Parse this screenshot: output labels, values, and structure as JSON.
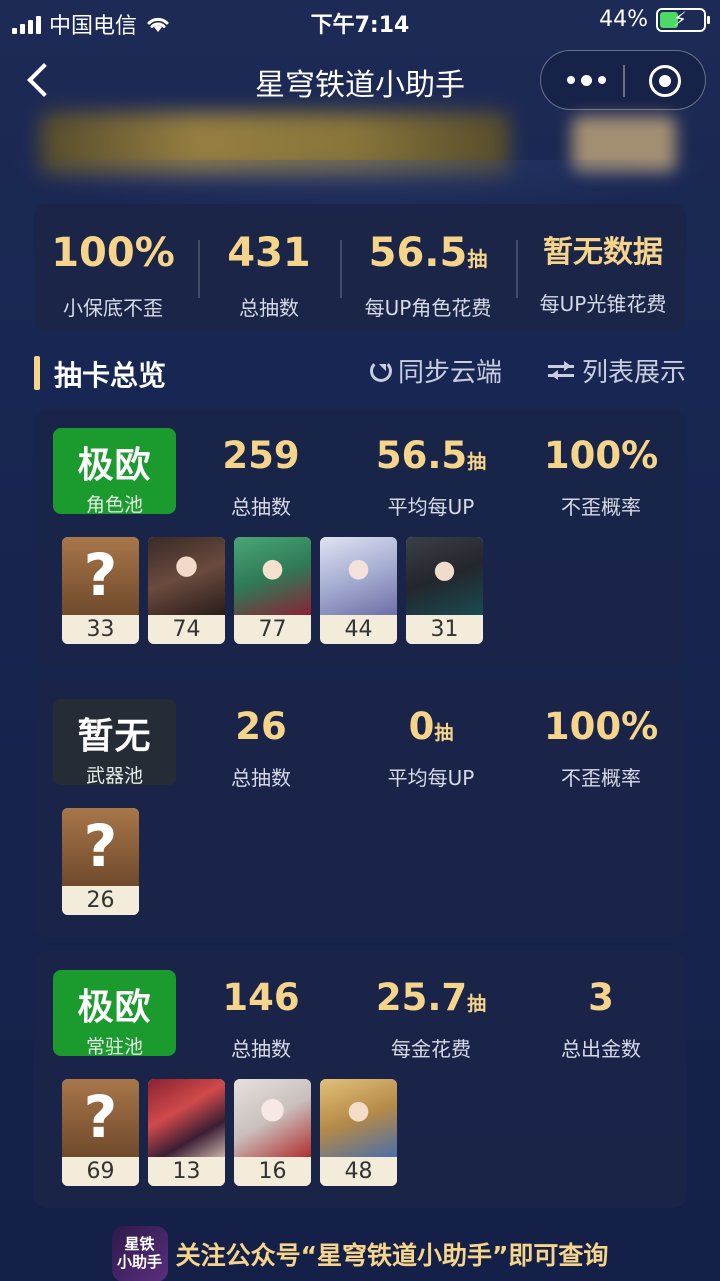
{
  "status": {
    "carrier": "中国电信",
    "time": "下午7:14",
    "battery": "44%"
  },
  "nav": {
    "title": "星穹铁道小助手"
  },
  "summary": [
    {
      "value": "100%",
      "unit": "",
      "label": "小保底不歪"
    },
    {
      "value": "431",
      "unit": "",
      "label": "总抽数"
    },
    {
      "value": "56.5",
      "unit": "抽",
      "label": "每UP角色花费"
    },
    {
      "value": "暂无数据",
      "unit": "",
      "label": "每UP光锥花费"
    }
  ],
  "section": {
    "title": "抽卡总览",
    "sync": "同步云端",
    "list": "列表展示"
  },
  "pools": [
    {
      "badge": "极欧",
      "badge_color": "#1b9a2e",
      "name": "角色池",
      "stats": [
        {
          "value": "259",
          "unit": "",
          "label": "总抽数"
        },
        {
          "value": "56.5",
          "unit": "抽",
          "label": "平均每UP"
        },
        {
          "value": "100%",
          "unit": "",
          "label": "不歪概率"
        }
      ],
      "pulls": [
        "33",
        "74",
        "77",
        "44",
        "31"
      ]
    },
    {
      "badge": "暂无",
      "badge_color": "#262c35",
      "name": "武器池",
      "stats": [
        {
          "value": "26",
          "unit": "",
          "label": "总抽数"
        },
        {
          "value": "0",
          "unit": "抽",
          "label": "平均每UP"
        },
        {
          "value": "100%",
          "unit": "",
          "label": "不歪概率"
        }
      ],
      "pulls": [
        "26"
      ]
    },
    {
      "badge": "极欧",
      "badge_color": "#1b9a2e",
      "name": "常驻池",
      "stats": [
        {
          "value": "146",
          "unit": "",
          "label": "总抽数"
        },
        {
          "value": "25.7",
          "unit": "抽",
          "label": "每金花费"
        },
        {
          "value": "3",
          "unit": "",
          "label": "总出金数"
        }
      ],
      "pulls": [
        "69",
        "13",
        "16",
        "48"
      ]
    }
  ],
  "footer": {
    "logo_text_1": "星铁",
    "logo_text_2": "小助手",
    "text": "关注公众号“星穹铁道小助手”即可查询"
  },
  "colors": {
    "accent": "#f6d58b",
    "success": "#1b9a2e",
    "card": "#1a2548"
  }
}
